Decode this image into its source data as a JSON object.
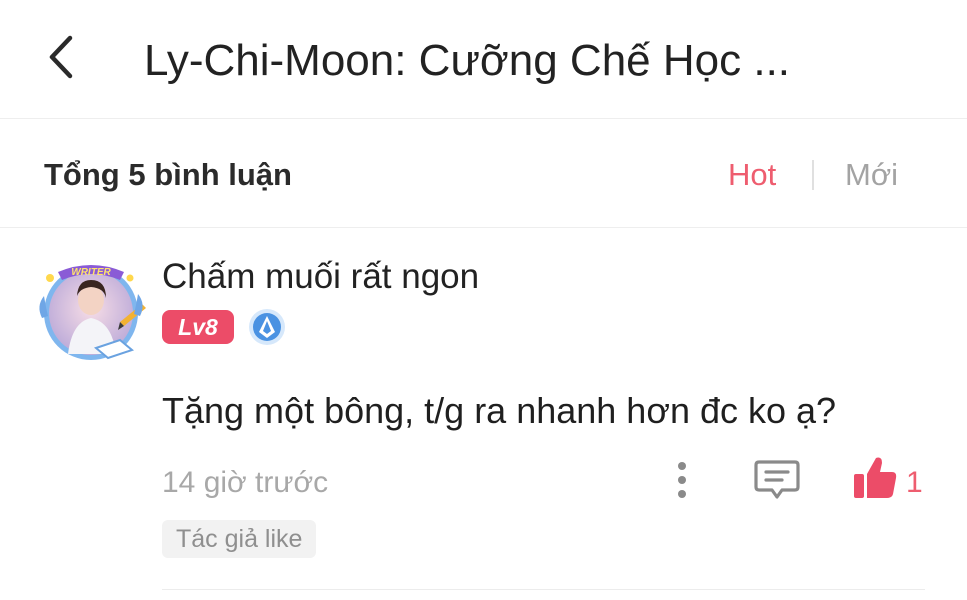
{
  "header": {
    "back_icon": "chevron-left-icon",
    "title": "Ly-Chi-Moon: Cưỡng Chế Học ..."
  },
  "sort_bar": {
    "total_label": "Tổng 5 bình luận",
    "tabs": [
      {
        "label": "Hot",
        "active": true,
        "color": "#ee5d6f"
      },
      {
        "label": "Mới",
        "active": false,
        "color": "#a3a3a3"
      }
    ]
  },
  "comments": [
    {
      "avatar_frame_text": "WRITER",
      "username": "Chấm muối rất ngon",
      "level": "Lv8",
      "rank_icon": "rank-badge-icon",
      "text": "Tặng một bông, t/g ra nhanh hơn đc ko ạ?",
      "time": "14 giờ trước",
      "more_icon": "more-vertical-icon",
      "reply_icon": "comment-icon",
      "like_icon": "thumbs-up-icon",
      "like_count": "1",
      "tag": "Tác giả like"
    }
  ],
  "colors": {
    "accent": "#ee5d6f",
    "level_badge": "#ec4c68",
    "muted_text": "#a8a8a8"
  }
}
